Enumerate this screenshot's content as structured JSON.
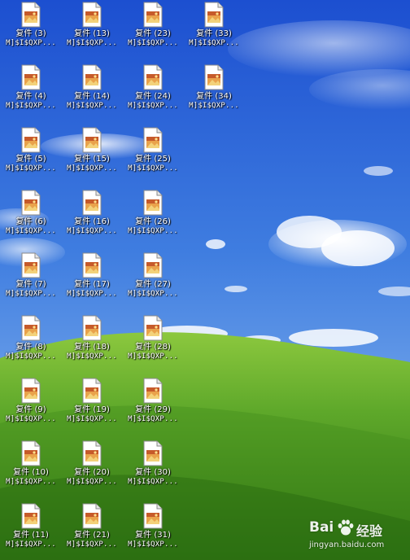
{
  "desktop": {
    "icons": [
      {
        "label": "复件 (3)",
        "subtitle": "M]$I$QXP..."
      },
      {
        "label": "复件 (4)",
        "subtitle": "M]$I$QXP..."
      },
      {
        "label": "复件 (5)",
        "subtitle": "M]$I$QXP..."
      },
      {
        "label": "复件 (6)",
        "subtitle": "M]$I$QXP..."
      },
      {
        "label": "复件 (7)",
        "subtitle": "M]$I$QXP..."
      },
      {
        "label": "复件 (8)",
        "subtitle": "M]$I$QXP..."
      },
      {
        "label": "复件 (9)",
        "subtitle": "M]$I$QXP..."
      },
      {
        "label": "复件 (10)",
        "subtitle": "M]$I$QXP..."
      },
      {
        "label": "复件 (11)",
        "subtitle": "M]$I$QXP..."
      },
      {
        "label": "复件 (13)",
        "subtitle": "M]$I$QXP..."
      },
      {
        "label": "复件 (14)",
        "subtitle": "M]$I$QXP..."
      },
      {
        "label": "复件 (15)",
        "subtitle": "M]$I$QXP..."
      },
      {
        "label": "复件 (16)",
        "subtitle": "M]$I$QXP..."
      },
      {
        "label": "复件 (17)",
        "subtitle": "M]$I$QXP..."
      },
      {
        "label": "复件 (18)",
        "subtitle": "M]$I$QXP..."
      },
      {
        "label": "复件 (19)",
        "subtitle": "M]$I$QXP..."
      },
      {
        "label": "复件 (20)",
        "subtitle": "M]$I$QXP..."
      },
      {
        "label": "复件 (21)",
        "subtitle": "M]$I$QXP..."
      },
      {
        "label": "复件 (23)",
        "subtitle": "M]$I$QXP..."
      },
      {
        "label": "复件 (24)",
        "subtitle": "M]$I$QXP..."
      },
      {
        "label": "复件 (25)",
        "subtitle": "M]$I$QXP..."
      },
      {
        "label": "复件 (26)",
        "subtitle": "M]$I$QXP..."
      },
      {
        "label": "复件 (27)",
        "subtitle": "M]$I$QXP..."
      },
      {
        "label": "复件 (28)",
        "subtitle": "M]$I$QXP..."
      },
      {
        "label": "复件 (29)",
        "subtitle": "M]$I$QXP..."
      },
      {
        "label": "复件 (30)",
        "subtitle": "M]$I$QXP..."
      },
      {
        "label": "复件 (31)",
        "subtitle": "M]$I$QXP..."
      },
      {
        "label": "复件 (33)",
        "subtitle": "M]$I$QXP..."
      },
      {
        "label": "复件 (34)",
        "subtitle": "M]$I$QXP..."
      }
    ],
    "icon_type": "image-file-icon"
  },
  "watermark": {
    "brand": "Bai",
    "brand_suffix": "经验",
    "url": "jingyan.baidu.com"
  },
  "colors": {
    "sky_top": "#1a4fcf",
    "sky_bottom": "#8bb8f0",
    "grass_light": "#7fc13a",
    "grass_dark": "#2f7a12"
  }
}
